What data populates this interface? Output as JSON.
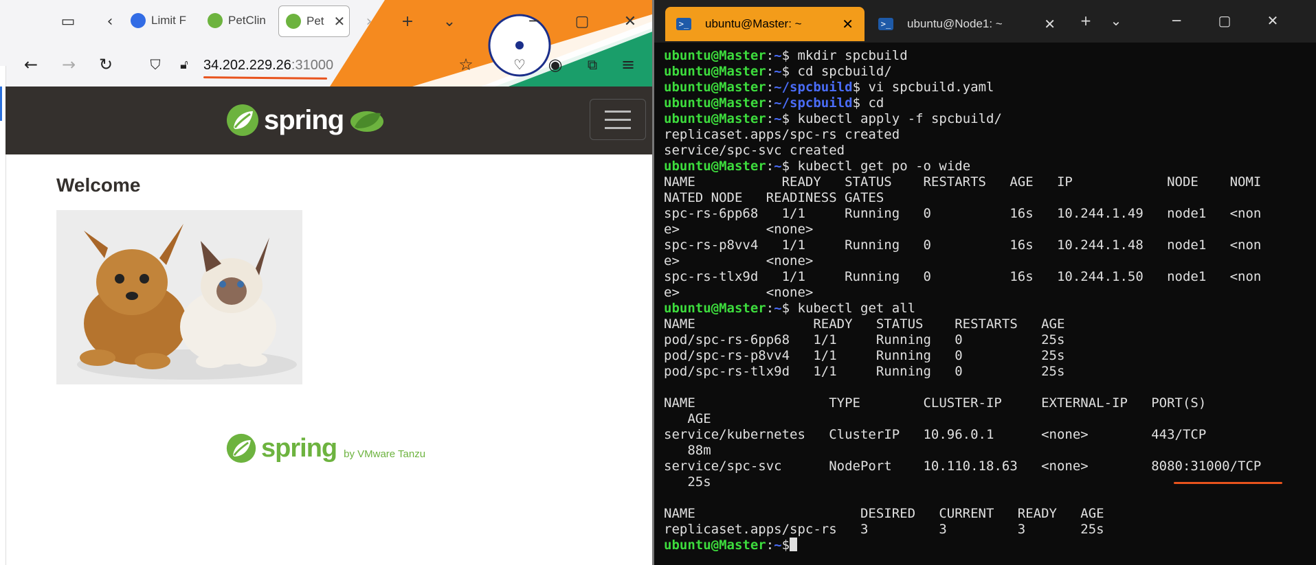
{
  "browser": {
    "tabs": [
      {
        "label": "Limit F",
        "icon": "kubernetes-icon"
      },
      {
        "label": "PetClin",
        "icon": "spring-leaf-icon"
      },
      {
        "label": "Pet",
        "icon": "spring-leaf-icon",
        "active": true
      }
    ],
    "url": {
      "host": "34.202.229.26",
      "port": ":31000"
    }
  },
  "app": {
    "logo_text": "spring",
    "welcome": "Welcome",
    "footer_logo_text": "spring",
    "footer_suffix": "by VMware Tanzu"
  },
  "terminal": {
    "tabs": [
      {
        "label": "ubuntu@Master: ~",
        "active": true
      },
      {
        "label": "ubuntu@Node1: ~",
        "active": false
      }
    ],
    "lines": [
      {
        "user": "ubuntu@Master",
        "sep": ":",
        "path": "~",
        "prompt": "$ ",
        "text": "mkdir spcbuild"
      },
      {
        "user": "ubuntu@Master",
        "sep": ":",
        "path": "~",
        "prompt": "$ ",
        "text": "cd spcbuild/"
      },
      {
        "user": "ubuntu@Master",
        "sep": ":",
        "path": "~/spcbuild",
        "prompt": "$ ",
        "text": "vi spcbuild.yaml"
      },
      {
        "user": "ubuntu@Master",
        "sep": ":",
        "path": "~/spcbuild",
        "prompt": "$ ",
        "text": "cd"
      },
      {
        "user": "ubuntu@Master",
        "sep": ":",
        "path": "~",
        "prompt": "$ ",
        "text": "kubectl apply -f spcbuild/"
      },
      {
        "text": "replicaset.apps/spc-rs created"
      },
      {
        "text": "service/spc-svc created"
      },
      {
        "user": "ubuntu@Master",
        "sep": ":",
        "path": "~",
        "prompt": "$ ",
        "text": "kubectl get po -o wide"
      },
      {
        "text": "NAME           READY   STATUS    RESTARTS   AGE   IP            NODE    NOMI"
      },
      {
        "text": "NATED NODE   READINESS GATES"
      },
      {
        "text": "spc-rs-6pp68   1/1     Running   0          16s   10.244.1.49   node1   <non"
      },
      {
        "text": "e>           <none>"
      },
      {
        "text": "spc-rs-p8vv4   1/1     Running   0          16s   10.244.1.48   node1   <non"
      },
      {
        "text": "e>           <none>"
      },
      {
        "text": "spc-rs-tlx9d   1/1     Running   0          16s   10.244.1.50   node1   <non"
      },
      {
        "text": "e>           <none>"
      },
      {
        "user": "ubuntu@Master",
        "sep": ":",
        "path": "~",
        "prompt": "$ ",
        "text": "kubectl get all"
      },
      {
        "text": "NAME               READY   STATUS    RESTARTS   AGE"
      },
      {
        "text": "pod/spc-rs-6pp68   1/1     Running   0          25s"
      },
      {
        "text": "pod/spc-rs-p8vv4   1/1     Running   0          25s"
      },
      {
        "text": "pod/spc-rs-tlx9d   1/1     Running   0          25s"
      },
      {
        "text": ""
      },
      {
        "text": "NAME                 TYPE        CLUSTER-IP     EXTERNAL-IP   PORT(S)"
      },
      {
        "text": "   AGE"
      },
      {
        "text": "service/kubernetes   ClusterIP   10.96.0.1      <none>        443/TCP"
      },
      {
        "text": "   88m"
      },
      {
        "text": "service/spc-svc      NodePort    10.110.18.63   <none>        8080:31000/TCP"
      },
      {
        "text": "   25s"
      },
      {
        "text": ""
      },
      {
        "text": "NAME                     DESIRED   CURRENT   READY   AGE"
      },
      {
        "text": "replicaset.apps/spc-rs   3         3         3       25s"
      },
      {
        "user": "ubuntu@Master",
        "sep": ":",
        "path": "~",
        "prompt": "$",
        "text": "",
        "cursor": true
      }
    ]
  },
  "colors": {
    "spring_green": "#6db33f",
    "header_dark": "#34302d",
    "terminal_bg": "#0c0c0c",
    "prompt_user": "#3ddc3d",
    "prompt_path": "#4a6cf7",
    "active_tab_orange": "#f39c1a",
    "annotation_orange": "#e8531d"
  }
}
